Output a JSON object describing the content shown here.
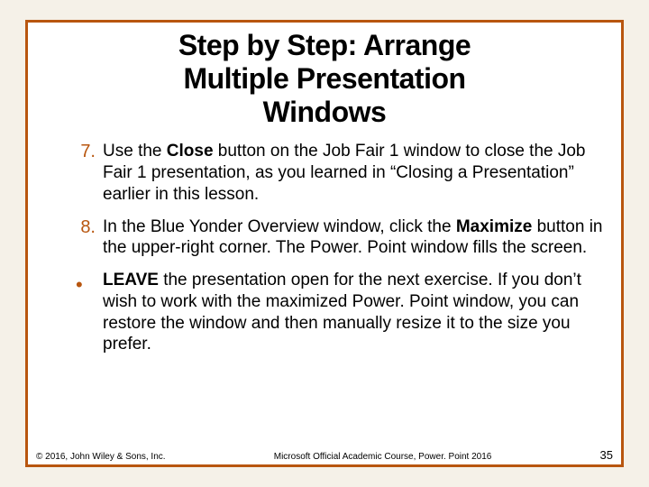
{
  "title_line1": "Step by Step: Arrange",
  "title_line2": "Multiple Presentation",
  "title_line3": "Windows",
  "items": [
    {
      "marker": "7.",
      "pre": "Use the ",
      "bold": "Close",
      "post": " button on the Job Fair 1 window to close the Job Fair 1 presentation, as you learned in “Closing a Presentation” earlier in this lesson."
    },
    {
      "marker": "8.",
      "pre": "In the Blue Yonder Overview window, click the ",
      "bold": "Maximize",
      "post": " button in the upper-right corner. The Power. Point window fills the screen."
    }
  ],
  "bullet": {
    "marker": "•",
    "bold": "LEAVE",
    "post": " the presentation open for the next exercise. If you don’t wish to work with the maximized Power. Point window, you can restore the window and then manually resize it to the size you prefer."
  },
  "footer": {
    "copyright": "© 2016, John Wiley & Sons, Inc.",
    "course": "Microsoft Official Academic Course, Power. Point 2016",
    "page": "35"
  }
}
